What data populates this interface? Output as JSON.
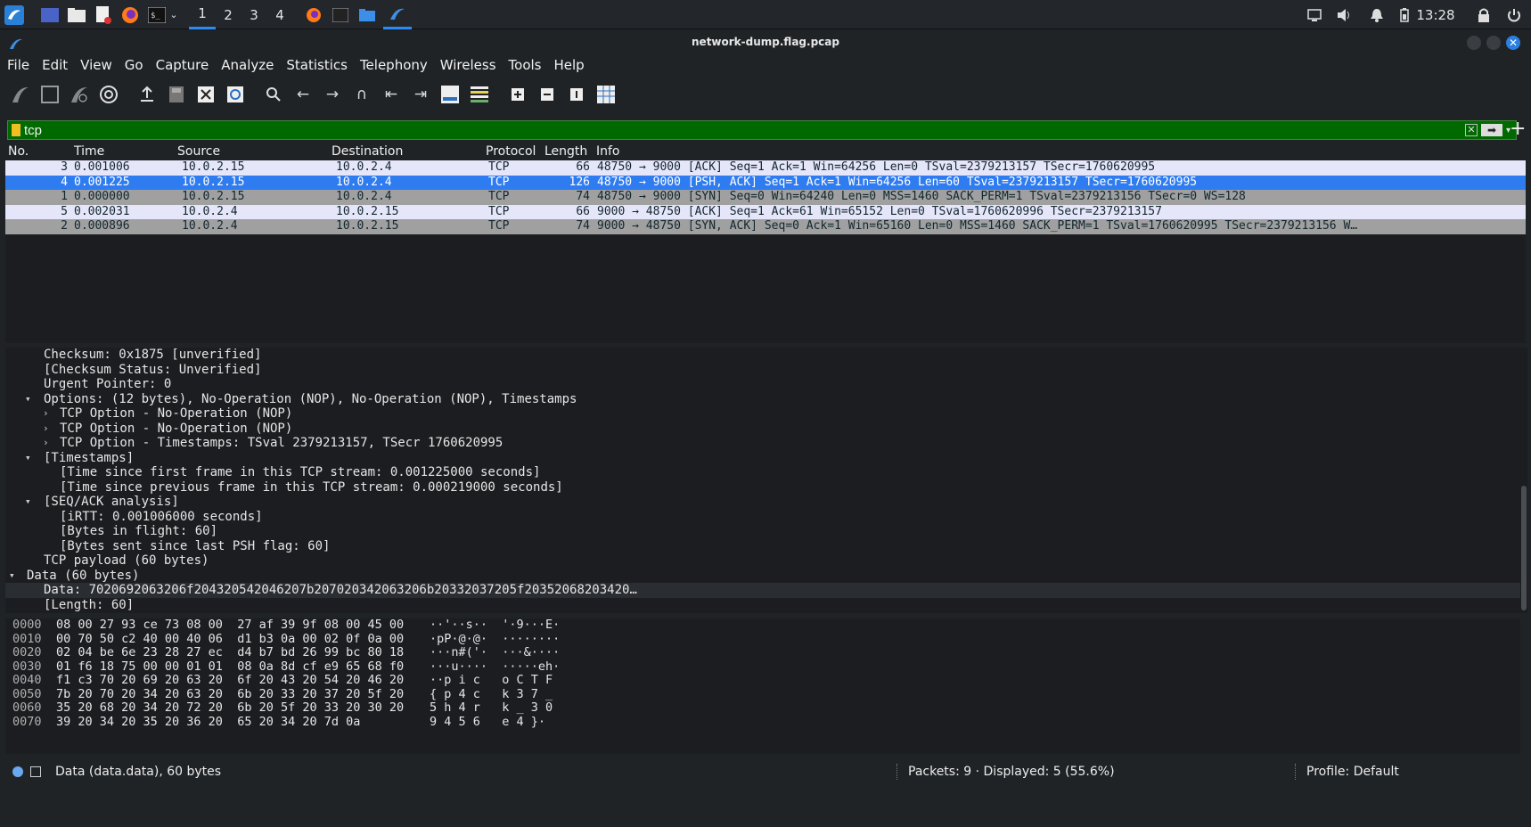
{
  "taskbar": {
    "workspaces": [
      "1",
      "2",
      "3",
      "4"
    ],
    "clock": "13:28"
  },
  "window": {
    "title": "network-dump.flag.pcap"
  },
  "menu": [
    "File",
    "Edit",
    "View",
    "Go",
    "Capture",
    "Analyze",
    "Statistics",
    "Telephony",
    "Wireless",
    "Tools",
    "Help"
  ],
  "filter": {
    "value": "tcp"
  },
  "packet_list": {
    "columns": [
      "No.",
      "Time",
      "Source",
      "Destination",
      "Protocol",
      "Length",
      "Info"
    ],
    "rows": [
      {
        "no": "3",
        "time": "0.001006",
        "src": "10.0.2.15",
        "dst": "10.0.2.4",
        "proto": "TCP",
        "len": "66",
        "info": "48750 → 9000 [ACK] Seq=1 Ack=1 Win=64256 Len=0 TSval=2379213157 TSecr=1760620995"
      },
      {
        "no": "4",
        "time": "0.001225",
        "src": "10.0.2.15",
        "dst": "10.0.2.4",
        "proto": "TCP",
        "len": "126",
        "info": "48750 → 9000 [PSH, ACK] Seq=1 Ack=1 Win=64256 Len=60 TSval=2379213157 TSecr=1760620995"
      },
      {
        "no": "1",
        "time": "0.000000",
        "src": "10.0.2.15",
        "dst": "10.0.2.4",
        "proto": "TCP",
        "len": "74",
        "info": "48750 → 9000 [SYN] Seq=0 Win=64240 Len=0 MSS=1460 SACK_PERM=1 TSval=2379213156 TSecr=0 WS=128"
      },
      {
        "no": "5",
        "time": "0.002031",
        "src": "10.0.2.4",
        "dst": "10.0.2.15",
        "proto": "TCP",
        "len": "66",
        "info": "9000 → 48750 [ACK] Seq=1 Ack=61 Win=65152 Len=0 TSval=1760620996 TSecr=2379213157"
      },
      {
        "no": "2",
        "time": "0.000896",
        "src": "10.0.2.4",
        "dst": "10.0.2.15",
        "proto": "TCP",
        "len": "74",
        "info": "9000 → 48750 [SYN, ACK] Seq=0 Ack=1 Win=65160 Len=0 MSS=1460 SACK_PERM=1 TSval=1760620995 TSecr=2379213156 W…"
      }
    ]
  },
  "details": [
    "Checksum: 0x1875 [unverified]",
    "[Checksum Status: Unverified]",
    "Urgent Pointer: 0",
    "Options: (12 bytes), No-Operation (NOP), No-Operation (NOP), Timestamps",
    "TCP Option - No-Operation (NOP)",
    "TCP Option - No-Operation (NOP)",
    "TCP Option - Timestamps: TSval 2379213157, TSecr 1760620995",
    "[Timestamps]",
    "[Time since first frame in this TCP stream: 0.001225000 seconds]",
    "[Time since previous frame in this TCP stream: 0.000219000 seconds]",
    "[SEQ/ACK analysis]",
    "[iRTT: 0.001006000 seconds]",
    "[Bytes in flight: 60]",
    "[Bytes sent since last PSH flag: 60]",
    "TCP payload (60 bytes)",
    "Data (60 bytes)",
    "Data: 7020692063206f204320542046207b207020342063206b20332037205f20352068203420…",
    "[Length: 60]"
  ],
  "bytes": [
    {
      "off": "0000",
      "hex": "08 00 27 93 ce 73 08 00  27 af 39 9f 08 00 45 00",
      "ascii": "··'··s··  '·9···E·"
    },
    {
      "off": "0010",
      "hex": "00 70 50 c2 40 00 40 06  d1 b3 0a 00 02 0f 0a 00",
      "ascii": "·pP·@·@·  ········"
    },
    {
      "off": "0020",
      "hex": "02 04 be 6e 23 28 27 ec  d4 b7 bd 26 99 bc 80 18",
      "ascii": "···n#('·  ···&····"
    },
    {
      "off": "0030",
      "hex": "01 f6 18 75 00 00 01 01  08 0a 8d cf e9 65 68 f0",
      "ascii": "···u····  ·····eh·"
    },
    {
      "off": "0040",
      "hex": "f1 c3 70 20 69 20 63 20  6f 20 43 20 54 20 46 20",
      "ascii": "··p i c   o C T F "
    },
    {
      "off": "0050",
      "hex": "7b 20 70 20 34 20 63 20  6b 20 33 20 37 20 5f 20",
      "ascii": "{ p 4 c   k 3 7 _ "
    },
    {
      "off": "0060",
      "hex": "35 20 68 20 34 20 72 20  6b 20 5f 20 33 20 30 20",
      "ascii": "5 h 4 r   k _ 3 0 "
    },
    {
      "off": "0070",
      "hex": "39 20 34 20 35 20 36 20  65 20 34 20 7d 0a",
      "ascii": "9 4 5 6   e 4 }·"
    }
  ],
  "status": {
    "field": "Data (data.data), 60 bytes",
    "packets": "Packets: 9 · Displayed: 5 (55.6%)",
    "profile": "Profile: Default"
  }
}
